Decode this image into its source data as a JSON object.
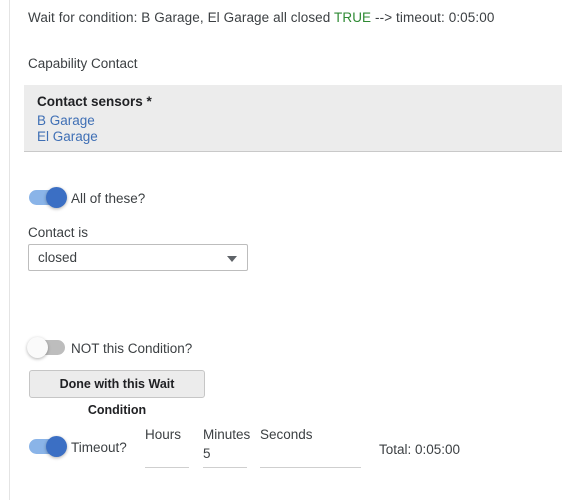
{
  "condition_summary": {
    "prefix": "Wait for condition: B Garage, El Garage all closed ",
    "state": "TRUE",
    "suffix": " --> timeout: 0:05:00",
    "state_color": "#2f8a34"
  },
  "capability": {
    "label": "Capability Contact"
  },
  "sensors_panel": {
    "title": "Contact sensors *",
    "devices": [
      {
        "name": "B Garage"
      },
      {
        "name": "El Garage"
      }
    ]
  },
  "all_of_these": {
    "label": "All of these?",
    "state": "on"
  },
  "contact_is": {
    "label": "Contact is",
    "selected": "closed",
    "options": [
      "closed"
    ]
  },
  "not_condition": {
    "label": "NOT this Condition?",
    "state": "off"
  },
  "done_button": {
    "label": "Done with this Wait Condition"
  },
  "timeout": {
    "label": "Timeout?",
    "state": "on",
    "fields": [
      {
        "caption": "Hours",
        "value": ""
      },
      {
        "caption": "Minutes",
        "value": "5"
      },
      {
        "caption": "Seconds",
        "value": ""
      }
    ],
    "total": "Total: 0:05:00"
  }
}
